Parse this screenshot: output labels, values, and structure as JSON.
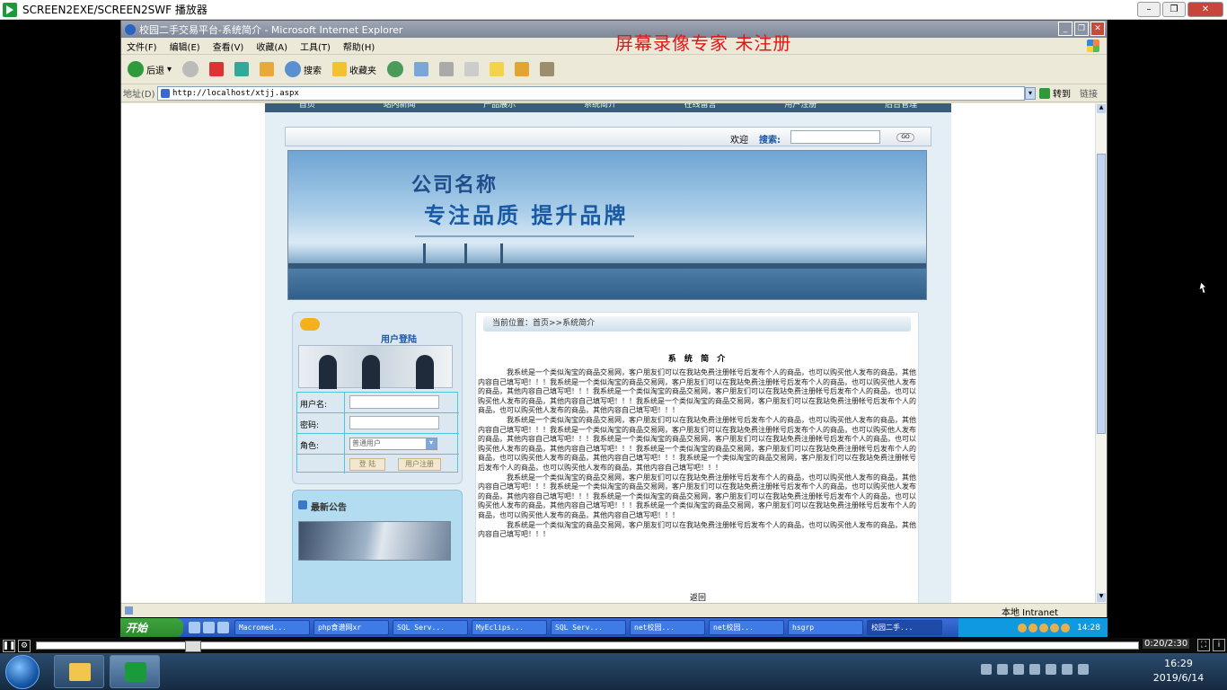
{
  "player": {
    "title": "SCREEN2EXE/SCREEN2SWF 播放器",
    "min": "–",
    "max": "❐",
    "close": "✕",
    "time": "0:20/2:30"
  },
  "ie": {
    "title": "校园二手交易平台-系统简介 - Microsoft Internet Explorer",
    "watermark": "屏幕录像专家  未注册",
    "menu": [
      "文件(F)",
      "编辑(E)",
      "查看(V)",
      "收藏(A)",
      "工具(T)",
      "帮助(H)"
    ],
    "toolbar": {
      "back": "后退",
      "search": "搜索",
      "favorites": "收藏夹"
    },
    "address_label": "地址(D)",
    "address": "http://localhost/xtjj.aspx",
    "go": "转到",
    "links": "链接",
    "zone": "本地 Intranet"
  },
  "site": {
    "nav": [
      "首页",
      "站内新闻",
      "产品展示",
      "系统简介",
      "在线留言",
      "用户注册",
      "后台管理"
    ],
    "welcome": "欢迎",
    "search_label": "搜索:",
    "search_go": "GO",
    "company": "公司名称",
    "slogan": "专注品质 提升品牌",
    "login": {
      "title": "用户登陆",
      "username_label": "用户名:",
      "password_label": "密码:",
      "role_label": "角色:",
      "role_value": "普通用户",
      "login_btn": "登 陆",
      "register_btn": "用户注册"
    },
    "notice_title": "最新公告",
    "breadcrumb": "当前位置：首页>>系统简介",
    "page_title": "系 统 简 介",
    "paragraphs": [
      "我系统是一个类似淘宝的商品交易网，客户朋友们可以在我站免费注册帐号后发布个人的商品，也可以购买他人发布的商品，其他内容自己填写吧！！！我系统是一个类似淘宝的商品交易网，客户朋友们可以在我站免费注册帐号后发布个人的商品，也可以购买他人发布的商品，其他内容自己填写吧！！！我系统是一个类似淘宝的商品交易网，客户朋友们可以在我站免费注册帐号后发布个人的商品，也可以购买他人发布的商品，其他内容自己填写吧！！！我系统是一个类似淘宝的商品交易网，客户朋友们可以在我站免费注册帐号后发布个人的商品，也可以购买他人发布的商品，其他内容自己填写吧！！！",
      "我系统是一个类似淘宝的商品交易网，客户朋友们可以在我站免费注册帐号后发布个人的商品，也可以购买他人发布的商品，其他内容自己填写吧！！！我系统是一个类似淘宝的商品交易网，客户朋友们可以在我站免费注册帐号后发布个人的商品，也可以购买他人发布的商品，其他内容自己填写吧！！！我系统是一个类似淘宝的商品交易网，客户朋友们可以在我站免费注册帐号后发布个人的商品，也可以购买他人发布的商品，其他内容自己填写吧！！！我系统是一个类似淘宝的商品交易网，客户朋友们可以在我站免费注册帐号后发布个人的商品，也可以购买他人发布的商品，其他内容自己填写吧！！！我系统是一个类似淘宝的商品交易网，客户朋友们可以在我站免费注册帐号后发布个人的商品，也可以购买他人发布的商品，其他内容自己填写吧！！！",
      "我系统是一个类似淘宝的商品交易网，客户朋友们可以在我站免费注册帐号后发布个人的商品，也可以购买他人发布的商品，其他内容自己填写吧！！！我系统是一个类似淘宝的商品交易网，客户朋友们可以在我站免费注册帐号后发布个人的商品，也可以购买他人发布的商品，其他内容自己填写吧！！！我系统是一个类似淘宝的商品交易网，客户朋友们可以在我站免费注册帐号后发布个人的商品，也可以购买他人发布的商品，其他内容自己填写吧！！！我系统是一个类似淘宝的商品交易网，客户朋友们可以在我站免费注册帐号后发布个人的商品，也可以购买他人发布的商品，其他内容自己填写吧！！！",
      "我系统是一个类似淘宝的商品交易网，客户朋友们可以在我站免费注册帐号后发布个人的商品，也可以购买他人发布的商品，其他内容自己填写吧！！！"
    ],
    "back": "返回"
  },
  "xp_taskbar": {
    "start": "开始",
    "tasks": [
      "Macromed...",
      "php食谱网xr",
      "SQL Serv...",
      "MyEclips...",
      "SQL Serv...",
      "net校园...",
      "net校园...",
      "hsgrp",
      "校园二手..."
    ],
    "time": "14:28"
  },
  "w7": {
    "time": "16:29",
    "date": "2019/6/14"
  }
}
